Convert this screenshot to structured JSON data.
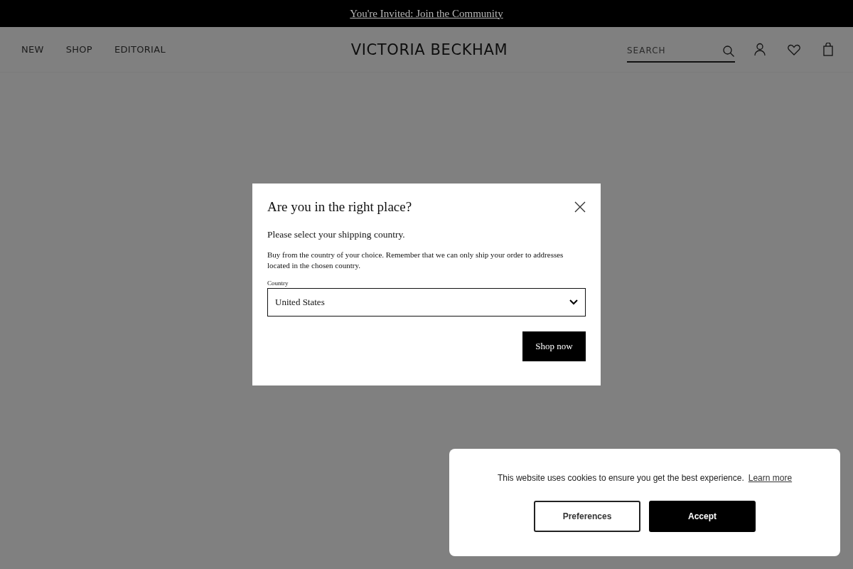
{
  "promo_bar": {
    "link": "You're Invited: Join the Community"
  },
  "header": {
    "nav": [
      "NEW",
      "SHOP",
      "EDITORIAL"
    ],
    "logo": "VICTORIA BECKHAM",
    "search": {
      "placeholder": "SEARCH"
    }
  },
  "dialog": {
    "title": "Are you in the right place?",
    "subtitle": "Please select your shipping country.",
    "body": "Buy from the country of your choice. Remember that we can only ship your order to addresses located in the chosen country.",
    "field_label": "Country",
    "country": "United States",
    "button": "Shop now"
  },
  "cookie_banner": {
    "message": "This website uses cookies to ensure you get the best experience.",
    "link": "Learn more",
    "buttons": [
      {
        "label": "Preferences",
        "kind": "secondary"
      },
      {
        "label": "Accept",
        "kind": "primary"
      }
    ]
  }
}
